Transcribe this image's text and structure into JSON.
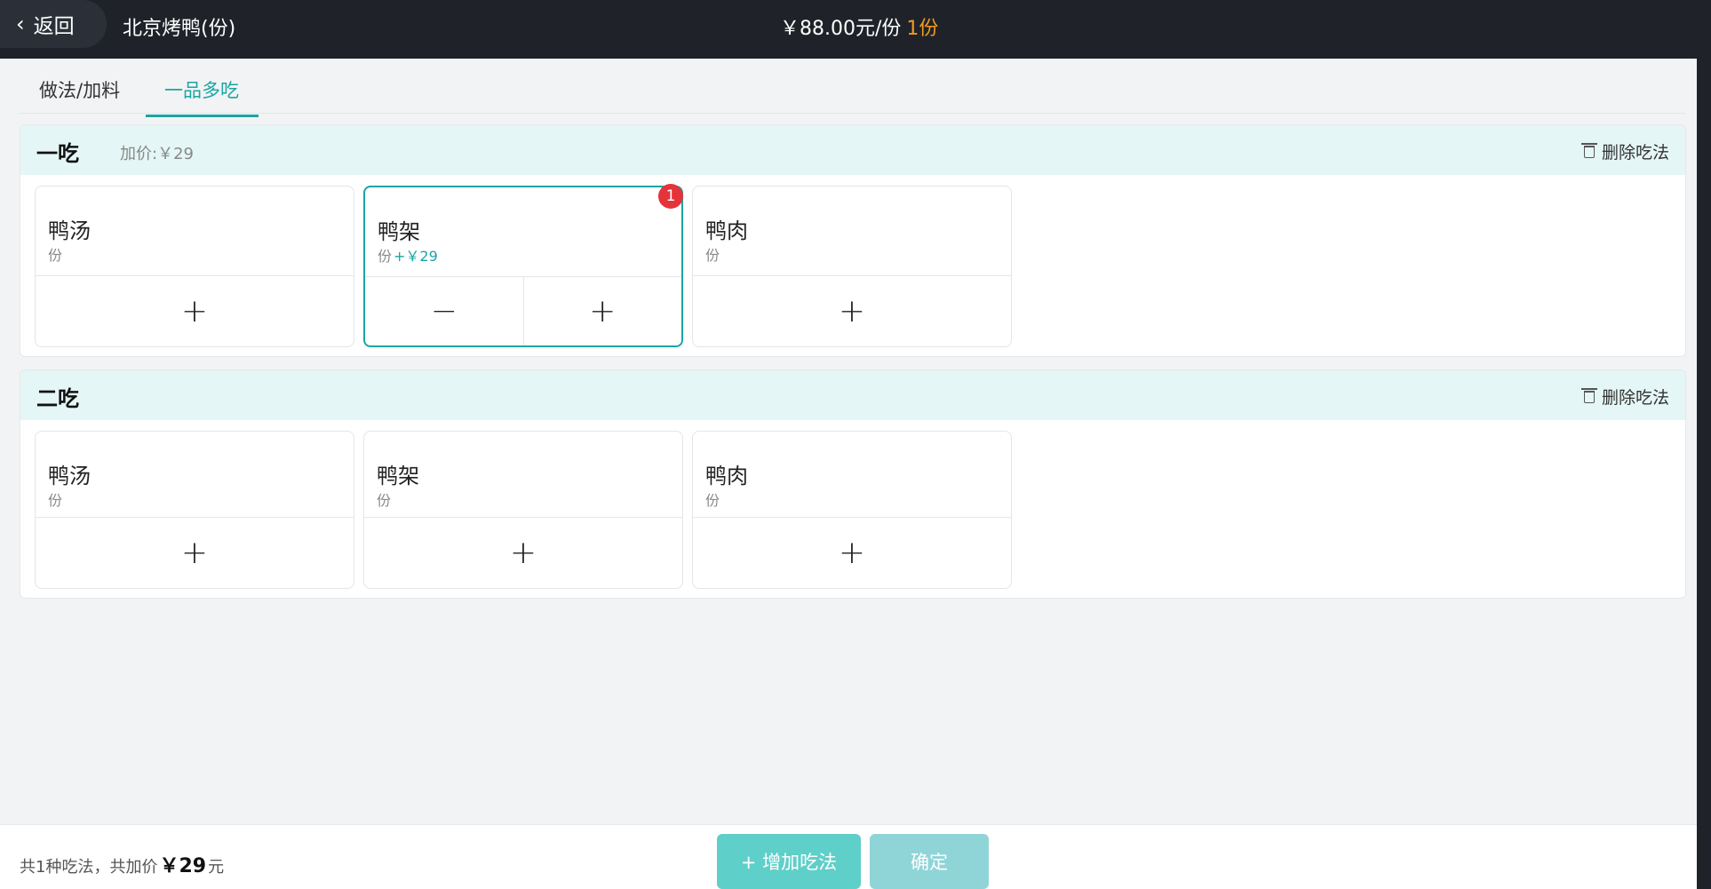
{
  "header": {
    "back_label": "返回",
    "dish_title": "北京烤鸭(份)",
    "price": "￥88.00元/份",
    "quantity": "1份"
  },
  "tabs": [
    {
      "label": "做法/加料",
      "active": false
    },
    {
      "label": "一品多吃",
      "active": true
    }
  ],
  "courses": [
    {
      "title": "一吃",
      "surcharge": "加价:￥29",
      "delete_label": "删除吃法",
      "items": [
        {
          "name": "鸭汤",
          "unit": "份",
          "extra": "",
          "count": 0
        },
        {
          "name": "鸭架",
          "unit": "份",
          "extra": "+￥29",
          "count": 1,
          "badge": "1"
        },
        {
          "name": "鸭肉",
          "unit": "份",
          "extra": "",
          "count": 0
        }
      ]
    },
    {
      "title": "二吃",
      "surcharge": "",
      "delete_label": "删除吃法",
      "items": [
        {
          "name": "鸭汤",
          "unit": "份",
          "extra": "",
          "count": 0
        },
        {
          "name": "鸭架",
          "unit": "份",
          "extra": "",
          "count": 0
        },
        {
          "name": "鸭肉",
          "unit": "份",
          "extra": "",
          "count": 0
        }
      ]
    }
  ],
  "controls": {
    "plus": "+",
    "minus": "−"
  },
  "footer": {
    "summary_prefix": "共1种吃法，共加价",
    "summary_amount": "￥29",
    "summary_suffix": "元",
    "add_label": "+ 增加吃法",
    "confirm_label": "确定"
  },
  "colors": {
    "accent": "#1ba5a3",
    "header_bg": "#1f2329",
    "badge": "#e5333a",
    "quantity": "#f39a1f"
  }
}
